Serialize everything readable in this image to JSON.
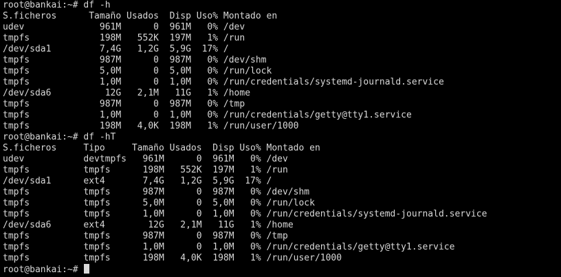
{
  "terminal": {
    "lines": [
      "root@bankai:~# df -h",
      "S.ficheros      Tamaño Usados  Disp Uso% Montado en",
      "udev              961M      0  961M   0% /dev",
      "tmpfs             198M   552K  197M   1% /run",
      "/dev/sda1         7,4G   1,2G  5,9G  17% /",
      "tmpfs             987M      0  987M   0% /dev/shm",
      "tmpfs             5,0M      0  5,0M   0% /run/lock",
      "tmpfs             1,0M      0  1,0M   0% /run/credentials/systemd-journald.service",
      "/dev/sda6          12G   2,1M   11G   1% /home",
      "tmpfs             987M      0  987M   0% /tmp",
      "tmpfs             1,0M      0  1,0M   0% /run/credentials/getty@tty1.service",
      "tmpfs             198M   4,0K  198M   1% /run/user/1000",
      "root@bankai:~# df -hT",
      "S.ficheros     Tipo     Tamaño Usados  Disp Uso% Montado en",
      "udev           devtmpfs   961M      0  961M   0% /dev",
      "tmpfs          tmpfs      198M   552K  197M   1% /run",
      "/dev/sda1      ext4       7,4G   1,2G  5,9G  17% /",
      "tmpfs          tmpfs      987M      0  987M   0% /dev/shm",
      "tmpfs          tmpfs      5,0M      0  5,0M   0% /run/lock",
      "tmpfs          tmpfs      1,0M      0  1,0M   0% /run/credentials/systemd-journald.service",
      "/dev/sda6      ext4        12G   2,1M   11G   1% /home",
      "tmpfs          tmpfs      987M      0  987M   0% /tmp",
      "tmpfs          tmpfs      1,0M      0  1,0M   0% /run/credentials/getty@tty1.service",
      "tmpfs          tmpfs      198M   4,0K  198M   1% /run/user/1000"
    ],
    "prompt": "root@bankai:~# ",
    "colors": {
      "background": "#000000",
      "foreground": "#d8d8d8"
    }
  }
}
